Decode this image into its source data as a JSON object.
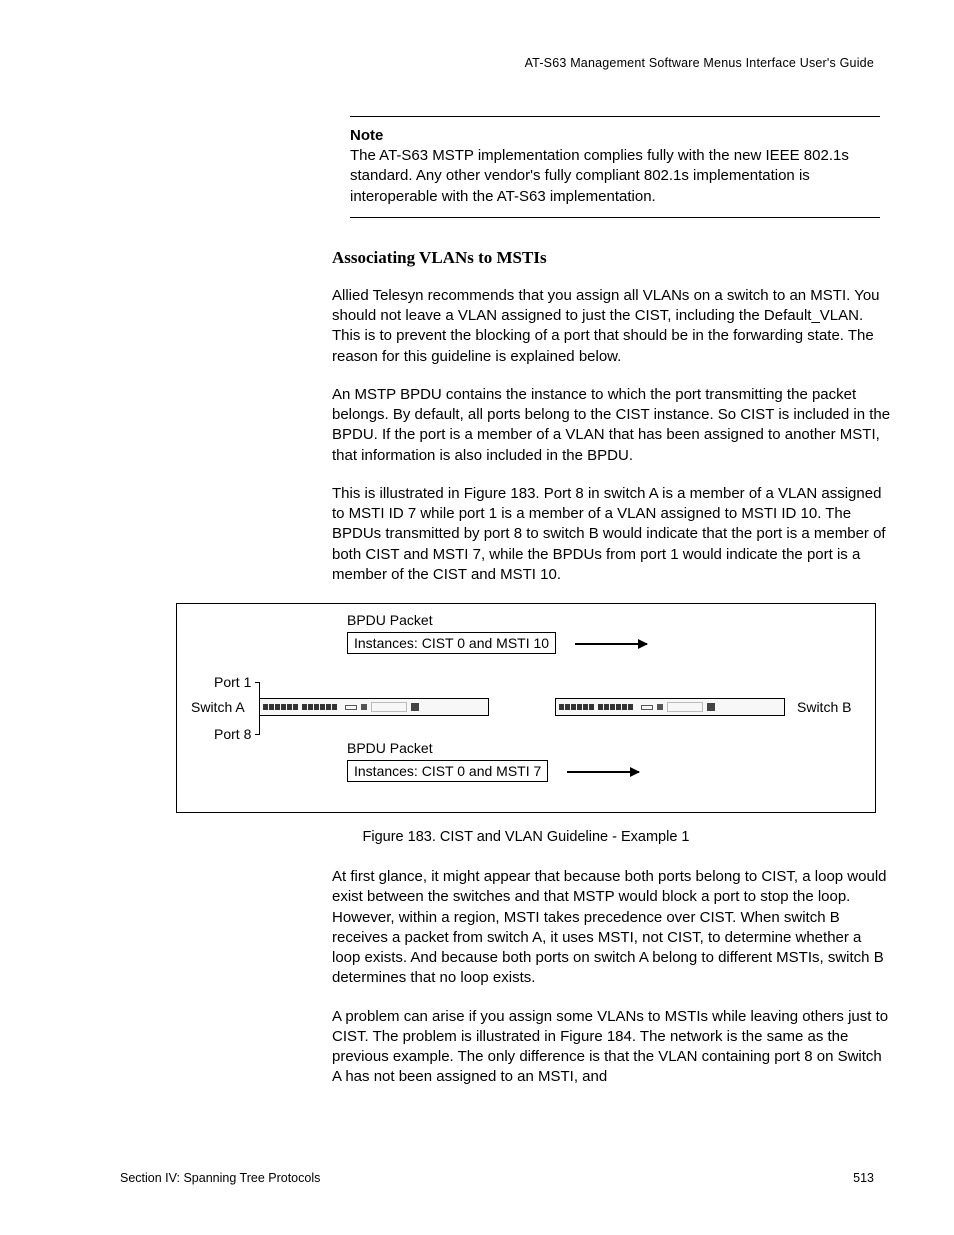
{
  "header": "AT-S63 Management Software Menus Interface User's Guide",
  "note": {
    "title": "Note",
    "body": "The AT-S63 MSTP implementation complies fully with the new IEEE 802.1s standard. Any other vendor's fully compliant 802.1s implementation is interoperable with the AT-S63 implementation."
  },
  "heading": "Associating VLANs to MSTIs",
  "p1": "Allied Telesyn recommends that you assign all VLANs on a switch to an MSTI. You should not leave a VLAN assigned to just the CIST, including the Default_VLAN. This is to prevent the blocking of a port that should be in the forwarding state. The reason for this guideline is explained below.",
  "p2": "An MSTP BPDU contains the instance to which the port transmitting the packet belongs. By default, all ports belong to the CIST instance. So CIST is included in the BPDU. If the port is a member of a VLAN that has been assigned to another MSTI, that information is also included in the BPDU.",
  "p3": "This is illustrated in Figure 183. Port 8 in switch A is a member of a VLAN assigned to MSTI ID 7 while port 1 is a member of a VLAN assigned to MSTI ID 10. The BPDUs transmitted by port 8 to switch B would indicate that the port is a member of both CIST and MSTI 7, while the BPDUs from port 1 would indicate the port is a member of the CIST and MSTI 10.",
  "figure": {
    "bpdu_top": "BPDU Packet",
    "inst_top": "Instances: CIST 0 and MSTI 10",
    "port1": "Port 1",
    "port8": "Port 8",
    "switchA": "Switch A",
    "switchB": "Switch B",
    "bpdu_bot": "BPDU Packet",
    "inst_bot": "Instances: CIST 0 and MSTI 7"
  },
  "caption": "Figure 183. CIST and VLAN Guideline - Example 1",
  "p4": "At first glance, it might appear that because both ports belong to CIST, a loop would exist between the switches and that MSTP would block a port to stop the loop. However, within a region, MSTI takes precedence over CIST. When switch B receives a packet from switch A, it uses MSTI, not CIST, to determine whether a loop exists. And because both ports on switch A belong to different MSTIs, switch B determines that no loop exists.",
  "p5": "A problem can arise if you assign some VLANs to MSTIs while leaving others just to CIST. The problem is illustrated in Figure 184. The network is the same as the previous example. The only difference is that the VLAN containing port 8 on Switch A has not been assigned to an MSTI, and",
  "footer": {
    "section": "Section IV: Spanning Tree Protocols",
    "page": "513"
  }
}
